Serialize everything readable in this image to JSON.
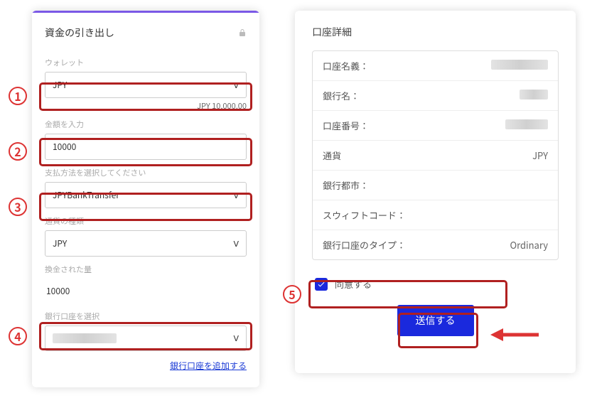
{
  "left": {
    "title": "資金の引き出し",
    "wallet_label": "ウォレット",
    "wallet_value": "JPY",
    "balance": "JPY 10,000.00",
    "amount_label": "金額を入力",
    "amount_value": "10000",
    "method_label": "支払方法を選択してください",
    "method_value": "JPYBankTransfer",
    "currency_label": "通貨の種類",
    "currency_value": "JPY",
    "converted_label": "換金された量",
    "converted_value": "10000",
    "bank_select_label": "銀行口座を選択",
    "add_bank_link": "銀行口座を追加する"
  },
  "right": {
    "title": "口座詳細",
    "rows": {
      "r0": "口座名義：",
      "r1": "銀行名：",
      "r2": "口座番号：",
      "r3": "通貨",
      "r3v": "JPY",
      "r4": "銀行都市：",
      "r5": "スウィフトコード：",
      "r6": "銀行口座のタイプ：",
      "r6v": "Ordinary"
    },
    "agree": "同意する",
    "submit": "送信する"
  },
  "markers": {
    "m1": "1",
    "m2": "2",
    "m3": "3",
    "m4": "4",
    "m5": "5"
  }
}
